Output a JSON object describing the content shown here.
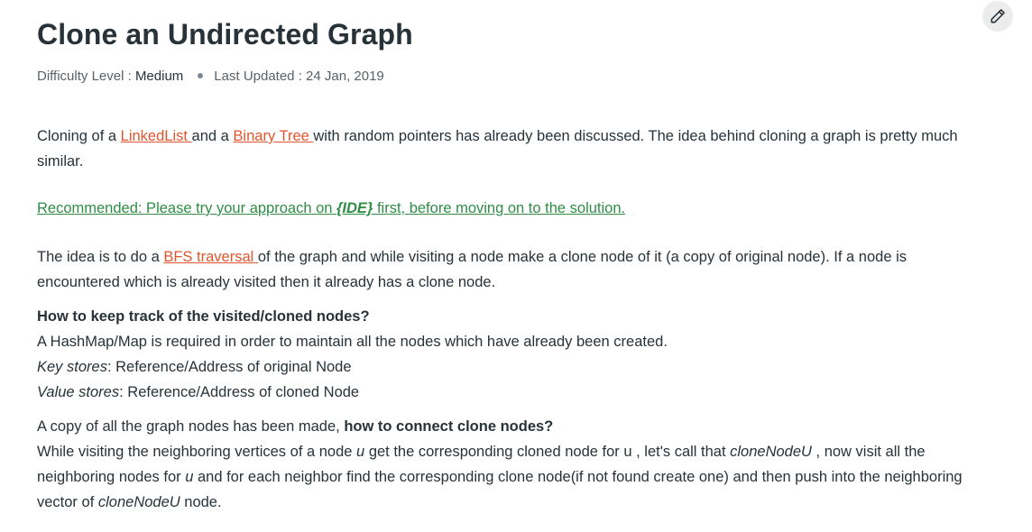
{
  "article": {
    "title": "Clone an Undirected Graph",
    "meta": {
      "difficulty_label": "Difficulty Level : ",
      "difficulty_value": "Medium",
      "updated_label": "Last Updated : ",
      "updated_value": "24 Jan, 2019"
    },
    "p1": {
      "t1": "Cloning of a ",
      "link1": "LinkedList ",
      "t2": "and a ",
      "link2": "Binary Tree ",
      "t3": "with random pointers has already been discussed. The idea behind cloning a graph is pretty much similar."
    },
    "recommended": {
      "t1": "Recommended: Please try your approach on ",
      "ide": "{IDE}",
      "t2": " first, before moving on to the solution."
    },
    "p2": {
      "t1": "The idea is to do a ",
      "link": "BFS traversal ",
      "t2": "of the graph and while visiting a node make a clone node of it (a copy of original node). If a node is encountered which is already visited then it already has a clone node."
    },
    "p3": {
      "heading": "How to keep track of the visited/cloned nodes?",
      "line1": "A HashMap/Map is required in order to maintain all the nodes which have already been created.",
      "key_label": "Key stores",
      "key_text": ": Reference/Address of original Node",
      "value_label": "Value stores",
      "value_text": ": Reference/Address of cloned Node"
    },
    "p4": {
      "t1": "A copy of all the graph nodes has been made, ",
      "bold": "how to connect clone nodes?",
      "t2": "While visiting the neighboring vertices of a node ",
      "u1": "u",
      "t3": " get the corresponding cloned node for u , let's call that ",
      "cn1": "cloneNodeU",
      "t4": " , now visit all the neighboring nodes for ",
      "u2": "u",
      "t5": " and for each neighbor find the corresponding clone node(if not found create one) and then push into the neighboring vector of ",
      "cn2": "cloneNodeU",
      "t6": " node."
    }
  },
  "icons": {
    "edit": "pencil-icon"
  },
  "colors": {
    "link": "#e0552d",
    "recommended": "#2f8d46",
    "text": "#273239"
  }
}
